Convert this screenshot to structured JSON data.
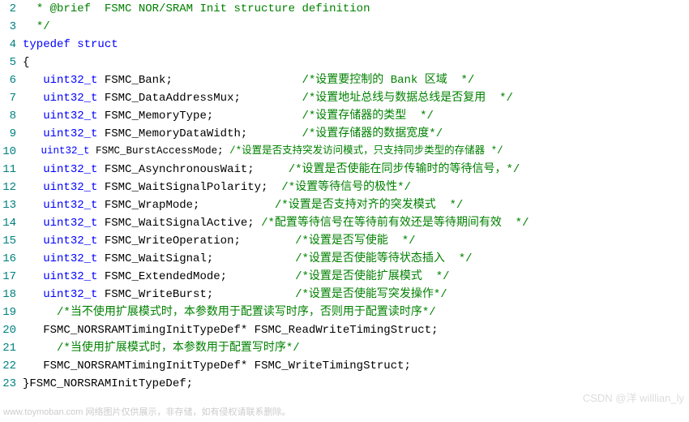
{
  "lineNumbers": [
    "2",
    "3",
    "4",
    "5",
    "6",
    "7",
    "8",
    "9",
    "10",
    "11",
    "12",
    "13",
    "14",
    "15",
    "16",
    "17",
    "18",
    "19",
    "20",
    "21",
    "22",
    "23"
  ],
  "lines": {
    "l2": {
      "indent": "  ",
      "c": "* @brief  FSMC NOR/SRAM Init structure definition"
    },
    "l3": {
      "indent": "  ",
      "c": "*/"
    },
    "l4": {
      "kw1": "typedef",
      "sp": " ",
      "kw2": "struct"
    },
    "l5": {
      "t": "{"
    },
    "l6": {
      "indent": "   ",
      "type": "uint32_t",
      "sp": " ",
      "id": "FSMC_Bank;",
      "pad": "                   ",
      "c": "/*设置要控制的 Bank 区域  */"
    },
    "l7": {
      "indent": "   ",
      "type": "uint32_t",
      "sp": " ",
      "id": "FSMC_DataAddressMux;",
      "pad": "         ",
      "c": "/*设置地址总线与数据总线是否复用  */"
    },
    "l8": {
      "indent": "   ",
      "type": "uint32_t",
      "sp": " ",
      "id": "FSMC_MemoryType;",
      "pad": "             ",
      "c": "/*设置存储器的类型  */"
    },
    "l9": {
      "indent": "   ",
      "type": "uint32_t",
      "sp": " ",
      "id": "FSMC_MemoryDataWidth;",
      "pad": "        ",
      "c": "/*设置存储器的数据宽度*/"
    },
    "l10": {
      "indent": "   ",
      "type": "uint32_t",
      "sp": " ",
      "id": "FSMC_BurstAccessMode; ",
      "c": "/*设置是否支持突发访问模式，只支持同步类型的存储器 */"
    },
    "l11": {
      "indent": "   ",
      "type": "uint32_t",
      "sp": " ",
      "id": "FSMC_AsynchronousWait;",
      "pad": "     ",
      "c": "/*设置是否使能在同步传输时的等待信号，*/"
    },
    "l12": {
      "indent": "   ",
      "type": "uint32_t",
      "sp": " ",
      "id": "FSMC_WaitSignalPolarity;",
      "pad": "  ",
      "c": "/*设置等待信号的极性*/"
    },
    "l13": {
      "indent": "   ",
      "type": "uint32_t",
      "sp": " ",
      "id": "FSMC_WrapMode;",
      "pad": "           ",
      "c": "/*设置是否支持对齐的突发模式  */"
    },
    "l14": {
      "indent": "   ",
      "type": "uint32_t",
      "sp": " ",
      "id": "FSMC_WaitSignalActive; ",
      "c": "/*配置等待信号在等待前有效还是等待期间有效  */"
    },
    "l15": {
      "indent": "   ",
      "type": "uint32_t",
      "sp": " ",
      "id": "FSMC_WriteOperation;",
      "pad": "        ",
      "c": "/*设置是否写使能  */"
    },
    "l16": {
      "indent": "   ",
      "type": "uint32_t",
      "sp": " ",
      "id": "FSMC_WaitSignal;",
      "pad": "            ",
      "c": "/*设置是否使能等待状态插入  */"
    },
    "l17": {
      "indent": "   ",
      "type": "uint32_t",
      "sp": " ",
      "id": "FSMC_ExtendedMode;",
      "pad": "          ",
      "c": "/*设置是否使能扩展模式  */"
    },
    "l18": {
      "indent": "   ",
      "type": "uint32_t",
      "sp": " ",
      "id": "FSMC_WriteBurst;",
      "pad": "            ",
      "c": "/*设置是否使能写突发操作*/"
    },
    "l19": {
      "indent": "     ",
      "c": "/*当不使用扩展模式时，本参数用于配置读写时序，否则用于配置读时序*/"
    },
    "l20": {
      "indent": "   ",
      "id": "FSMC_NORSRAMTimingInitTypeDef* FSMC_ReadWriteTimingStruct;"
    },
    "l21": {
      "indent": "     ",
      "c": "/*当使用扩展模式时，本参数用于配置写时序*/"
    },
    "l22": {
      "indent": "   ",
      "id": "FSMC_NORSRAMTimingInitTypeDef* FSMC_WriteTimingStruct;"
    },
    "l23": {
      "t": "}FSMC_NORSRAMInitTypeDef;"
    }
  },
  "watermark": {
    "bottom": "www.toymoban.com  网络图片仅供展示，非存储，如有侵权请联系删除。",
    "right": "CSDN @洋 willlian_ly"
  }
}
